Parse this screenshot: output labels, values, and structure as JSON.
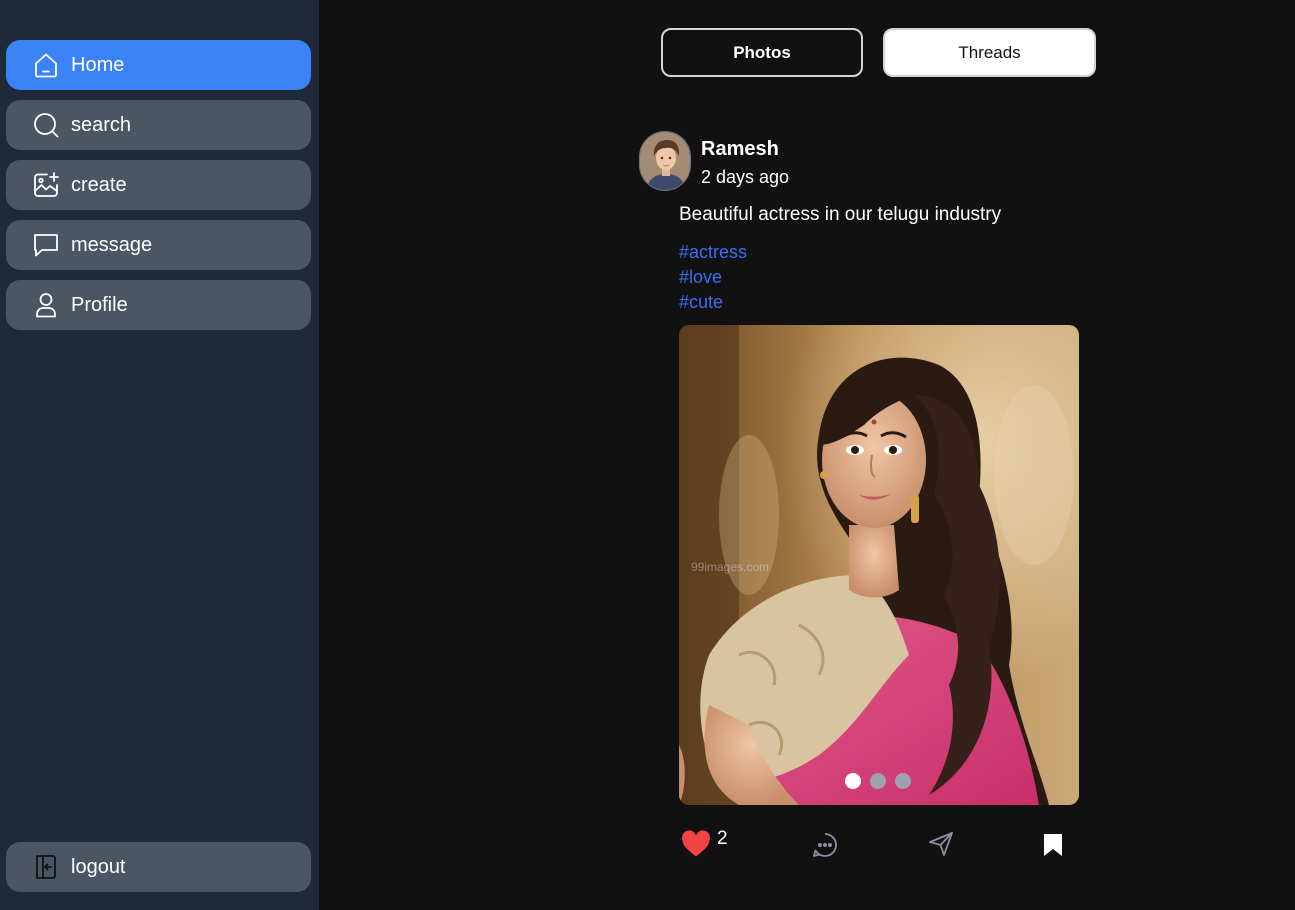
{
  "sidebar": {
    "items": [
      {
        "label": "Home",
        "icon": "home-icon",
        "active": true
      },
      {
        "label": "search",
        "icon": "search-icon"
      },
      {
        "label": "create",
        "icon": "image-add-icon"
      },
      {
        "label": "message",
        "icon": "message-icon"
      },
      {
        "label": "Profile",
        "icon": "user-icon"
      }
    ],
    "logout": {
      "label": "logout",
      "icon": "logout-icon"
    }
  },
  "tabs": {
    "photos": "Photos",
    "threads": "Threads"
  },
  "post": {
    "username": "Ramesh",
    "time": "2 days ago",
    "caption": "Beautiful actress in our telugu industry",
    "hashtags": [
      "#actress",
      "#love",
      "#cute"
    ],
    "watermark": "99images.com",
    "carousel": {
      "count": 3,
      "active_index": 0
    },
    "likes": "2"
  },
  "colors": {
    "sidebar_bg": "#1f2937",
    "nav_item_bg": "#4b5563",
    "active_nav_bg": "#3b82f6",
    "main_bg": "#111111",
    "hashtag": "#3b6ef5",
    "like_heart": "#ef4444"
  }
}
